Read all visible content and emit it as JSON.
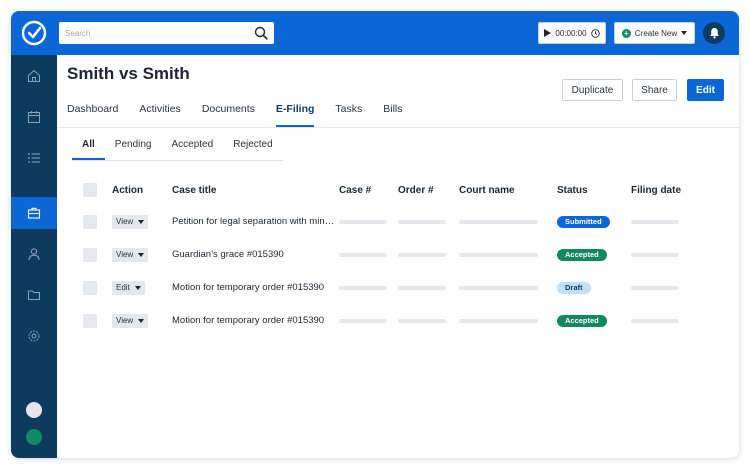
{
  "colors": {
    "brand": "#0b67d6",
    "sidebar": "#0d3b5e",
    "submitted": "#0b67d6",
    "accepted": "#118862",
    "draft": "#bfe1f8"
  },
  "topbar": {
    "search_placeholder": "Search",
    "timer": "00:00:00",
    "create_new": "Create New"
  },
  "header": {
    "title": "Smith vs Smith",
    "duplicate": "Duplicate",
    "share": "Share",
    "edit": "Edit"
  },
  "nav_tabs": [
    "Dashboard",
    "Activities",
    "Documents",
    "E-Filing",
    "Tasks",
    "Bills"
  ],
  "sub_tabs": [
    "All",
    "Pending",
    "Accepted",
    "Rejected"
  ],
  "table": {
    "headers": {
      "action": "Action",
      "case_title": "Case title",
      "case_no": "Case #",
      "order_no": "Order #",
      "court_name": "Court name",
      "status": "Status",
      "filing_date": "Filing date"
    },
    "rows": [
      {
        "action": "View",
        "title": "Petition for legal separation with min…",
        "status": "Submitted"
      },
      {
        "action": "View",
        "title": "Guardian’s grace #015390",
        "status": "Accepted"
      },
      {
        "action": "Edit",
        "title": "Motion for temporary order #015390",
        "status": "Draft"
      },
      {
        "action": "View",
        "title": "Motion for temporary order #015390",
        "status": "Accepted"
      }
    ]
  }
}
